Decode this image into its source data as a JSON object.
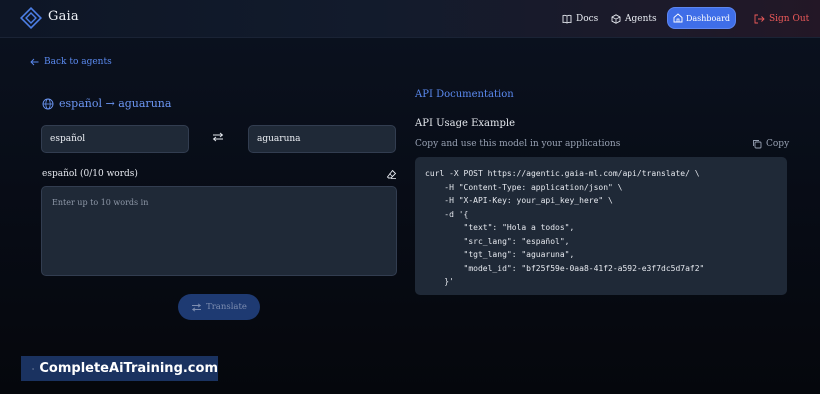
{
  "header": {
    "brand": "Gaia",
    "nav": {
      "docs": "Docs",
      "agents": "Agents",
      "dashboard": "Dashboard",
      "sign_out": "Sign Out"
    }
  },
  "back_link": "Back to agents",
  "translator": {
    "pair_title": "español → aguaruna",
    "source_lang": "español",
    "target_lang": "aguaruna",
    "word_count_label": "español (0/10 words)",
    "input_placeholder": "Enter up to 10 words in",
    "translate_button": "Translate"
  },
  "api": {
    "section_title": "API Documentation",
    "usage_title": "API Usage Example",
    "usage_subtitle": "Copy and use this model in your applications",
    "copy_label": "Copy",
    "code": "curl -X POST https://agentic.gaia-ml.com/api/translate/ \\\n    -H \"Content-Type: application/json\" \\\n    -H \"X-API-Key: your_api_key_here\" \\\n    -d '{\n        \"text\": \"Hola a todos\",\n        \"src_lang\": \"español\",\n        \"tgt_lang\": \"aguaruna\",\n        \"model_id\": \"bf25f59e-0aa8-41f2-a592-e3f7dc5d7af2\"\n    }'"
  },
  "watermark": "CompleteAiTraining.com",
  "colors": {
    "accent": "#3f6ee8",
    "link": "#5b8af0",
    "sign_out": "#ee5a5a",
    "panel": "#1f2937"
  }
}
